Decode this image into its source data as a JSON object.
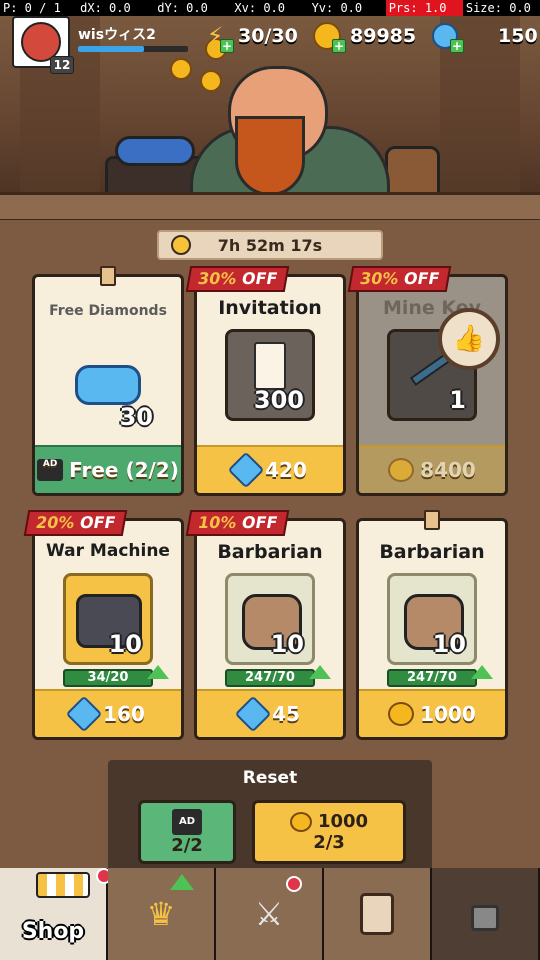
{
  "debug": [
    "P: 0 / 1",
    "dX: 0.0",
    "dY: 0.0",
    "Xv: 0.0",
    "Yv: 0.0",
    "Prs: 1.0",
    "Size: 0.0"
  ],
  "player": {
    "name": "wisウィス2",
    "level": "12",
    "xp_fraction": 0.6
  },
  "resources": {
    "energy": "30/30",
    "gold": "89985",
    "diamonds": "150"
  },
  "timer": "7h 52m 17s",
  "cards": [
    {
      "title": "Free Diamonds",
      "qty": "30",
      "price": "Free (2/2)",
      "currency": "ad"
    },
    {
      "title": "Invitation",
      "qty": "300",
      "price": "420",
      "currency": "diamond",
      "discount_pct": "30%",
      "discount_word": "OFF"
    },
    {
      "title": "Mine Key",
      "qty": "1",
      "price": "8400",
      "currency": "gold",
      "discount_pct": "30%",
      "discount_word": "OFF"
    },
    {
      "title": "War Machine",
      "qty": "10",
      "progress": "34/20",
      "price": "160",
      "currency": "diamond",
      "discount_pct": "20%",
      "discount_word": "OFF"
    },
    {
      "title": "Barbarian",
      "qty": "10",
      "progress": "247/70",
      "price": "45",
      "currency": "diamond",
      "discount_pct": "10%",
      "discount_word": "OFF"
    },
    {
      "title": "Barbarian",
      "qty": "10",
      "progress": "247/70",
      "price": "1000",
      "currency": "gold"
    }
  ],
  "reset": {
    "title": "Reset",
    "ad_label": "AD",
    "ad_count": "2/2",
    "gold_cost": "1000",
    "gold_count": "2/3"
  },
  "nav": {
    "shop": "Shop"
  },
  "icons": {
    "energy": "lightning-icon",
    "gold": "crown-coin-icon",
    "diamond": "diamond-icon",
    "tabs": [
      "shop-icon",
      "crown-icon",
      "crossed-swords-icon",
      "card-icon",
      "lock-icon"
    ]
  },
  "colors": {
    "price_yellow": "#f6c245",
    "price_green": "#4ea96f",
    "discount_red": "#c2282e",
    "diamond_blue": "#5ab8f0"
  }
}
